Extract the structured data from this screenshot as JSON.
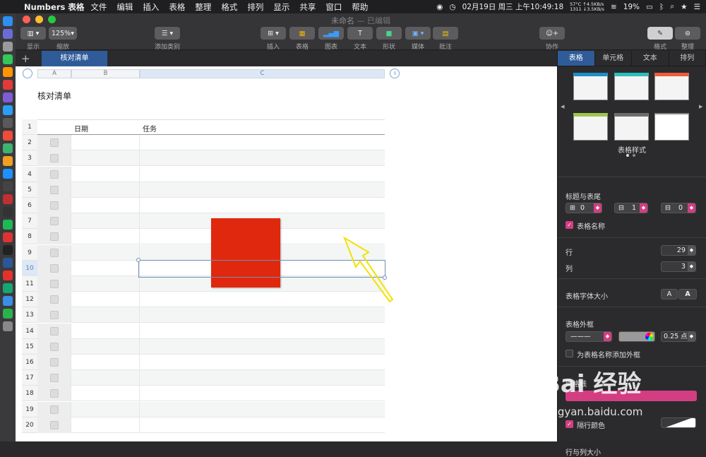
{
  "menubar": {
    "app": "Numbers 表格",
    "items": [
      "文件",
      "编辑",
      "插入",
      "表格",
      "整理",
      "格式",
      "排列",
      "显示",
      "共享",
      "窗口",
      "帮助"
    ],
    "status": {
      "temp": "57°C",
      "net_up": "↑4.5KB/s",
      "fan": "1311",
      "net_down": "↓3.5KB/s",
      "clock": "02月19日 周三 上午10:49:18",
      "battery": "19%"
    }
  },
  "window": {
    "title": "未命名",
    "subtitle": "— 已编辑"
  },
  "toolbar": {
    "view": "显示",
    "zoom_value": "125%",
    "zoom": "缩放",
    "add_category": "添加类别",
    "insert": "插入",
    "table": "表格",
    "chart": "图表",
    "text": "文本",
    "shape": "形状",
    "media": "媒体",
    "comment": "批注",
    "collaborate": "协作",
    "format": "格式",
    "organize": "整理"
  },
  "sheet": {
    "tab": "核对清单"
  },
  "table": {
    "title": "核对清单",
    "columns": [
      "A",
      "B",
      "C"
    ],
    "header": {
      "date": "日期",
      "task": "任务"
    },
    "rows": [
      "1",
      "2",
      "3",
      "4",
      "5",
      "6",
      "7",
      "8",
      "9",
      "10",
      "11",
      "12",
      "13",
      "14",
      "15",
      "16",
      "17",
      "18",
      "19",
      "20"
    ]
  },
  "inspector": {
    "tabs": [
      "表格",
      "单元格",
      "文本",
      "排列"
    ],
    "style_label": "表格样式",
    "header_footer": "标题与表尾",
    "header_rows": "0",
    "header_cols": "1",
    "footer_rows": "0",
    "table_name": "表格名称",
    "rows_label": "行",
    "rows": "29",
    "cols_label": "列",
    "cols": "3",
    "font_size": "表格字体大小",
    "font_small": "A",
    "font_large": "A",
    "outline": "表格外框",
    "outline_width": "0.25 点",
    "outline_title": "为表格名称添加外框",
    "gridlines": "网格线",
    "alt_row": "隔行颜色",
    "row_col_size": "行与列大小"
  },
  "watermark": {
    "brand": "Bai  经验",
    "url": "jingyan.baidu.com"
  },
  "colors": {
    "accent": "#2f5c99",
    "shape": "#e0280e",
    "highlight": "#d33e82"
  }
}
